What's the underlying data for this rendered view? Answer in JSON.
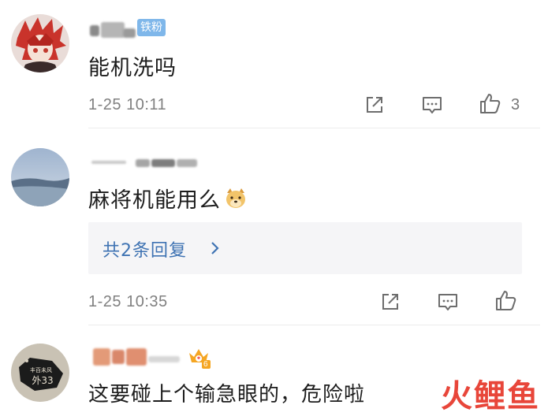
{
  "comments": [
    {
      "badge": "铁粉",
      "text": "能机洗吗",
      "time": "1-25 10:11",
      "likes": "3"
    },
    {
      "text": "麻将机能用么",
      "emoji": "doge-emoji",
      "replies_label": "共2条回复",
      "time": "1-25 10:35"
    },
    {
      "text": "这要碰上个输急眼的，危险啦",
      "avatar_text": [
        "丰百未风",
        "外33"
      ],
      "vip_level": "6"
    }
  ],
  "icons": {
    "share": "share-icon",
    "comment": "comment-icon",
    "like": "thumbs-up-icon",
    "chevron": "chevron-right-icon",
    "vip": "crown-badge-icon"
  },
  "watermark": "火鲤鱼",
  "colors": {
    "badge_bg": "#7fb7ea",
    "link": "#3f73b3",
    "watermark": "#e8463a",
    "meta": "#808080"
  }
}
